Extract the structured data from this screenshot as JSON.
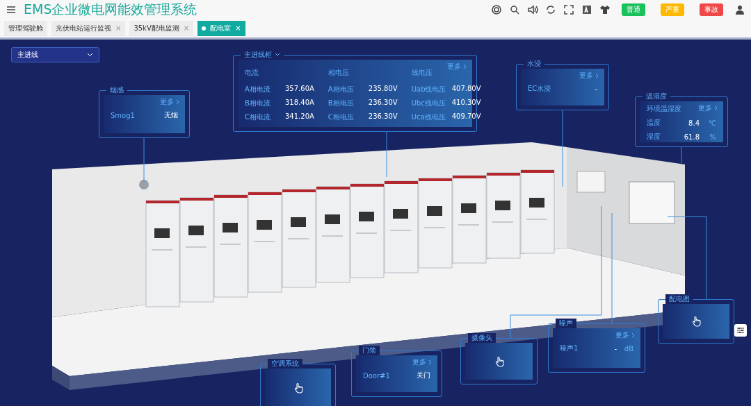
{
  "header": {
    "title": "EMS企业微电网能效管理系统",
    "alarms": [
      {
        "label": "普通",
        "color": "#19c15b"
      },
      {
        "label": "严重",
        "color": "#ffb800"
      },
      {
        "label": "事故",
        "color": "#f04848"
      }
    ]
  },
  "tabs": [
    {
      "label": "管理驾驶舱",
      "selected": false
    },
    {
      "label": "光伏电站运行监视",
      "close": "×",
      "selected": false
    },
    {
      "label": "35kV配电监测",
      "close": "×",
      "selected": false
    },
    {
      "label": "配电室",
      "close": "×",
      "selected": true
    }
  ],
  "dropdown": {
    "value": "主进线"
  },
  "panels": [
    {
      "kind": "readings",
      "title": "烟感",
      "more": "更多",
      "rows": [
        {
          "label": "Smog1",
          "value": "无烟"
        }
      ]
    },
    {
      "kind": "grid",
      "title": "主进线柜",
      "more": "更多",
      "columns": [
        {
          "heading": "电流",
          "rows": [
            {
              "label": "A相电流",
              "value": "357.60A"
            },
            {
              "label": "B相电流",
              "value": "318.40A"
            },
            {
              "label": "C相电流",
              "value": "341.20A"
            }
          ]
        },
        {
          "heading": "相电压",
          "rows": [
            {
              "label": "A相电压",
              "value": "235.80V"
            },
            {
              "label": "B相电压",
              "value": "236.30V"
            },
            {
              "label": "C相电压",
              "value": "236.30V"
            }
          ]
        },
        {
          "heading": "线电压",
          "rows": [
            {
              "label": "Uab线电压",
              "value": "407.80V"
            },
            {
              "label": "Ubc线电压",
              "value": "410.30V"
            },
            {
              "label": "Uca线电压",
              "value": "409.70V"
            }
          ]
        }
      ]
    },
    {
      "kind": "readings",
      "title": "水浸",
      "more": "更多",
      "rows": [
        {
          "label": "EC水浸",
          "value": "-"
        }
      ]
    },
    {
      "kind": "readings",
      "title": "温湿度",
      "subtitle": "环境温湿度",
      "more": "更多",
      "rows": [
        {
          "label": "温度",
          "value": "8.4",
          "unit": "℃"
        },
        {
          "label": "湿度",
          "value": "61.8",
          "unit": "%"
        }
      ]
    },
    {
      "kind": "link",
      "title": "空调系统"
    },
    {
      "kind": "readings",
      "title": "门禁",
      "more": "更多",
      "rows": [
        {
          "label": "Door#1",
          "value": "关门"
        }
      ]
    },
    {
      "kind": "link",
      "title": "摄像头"
    },
    {
      "kind": "readings",
      "title": "噪声",
      "more": "更多",
      "rows": [
        {
          "label": "噪声1",
          "value": "-",
          "unit": "dB"
        }
      ]
    },
    {
      "kind": "link",
      "title": "配电图"
    }
  ]
}
